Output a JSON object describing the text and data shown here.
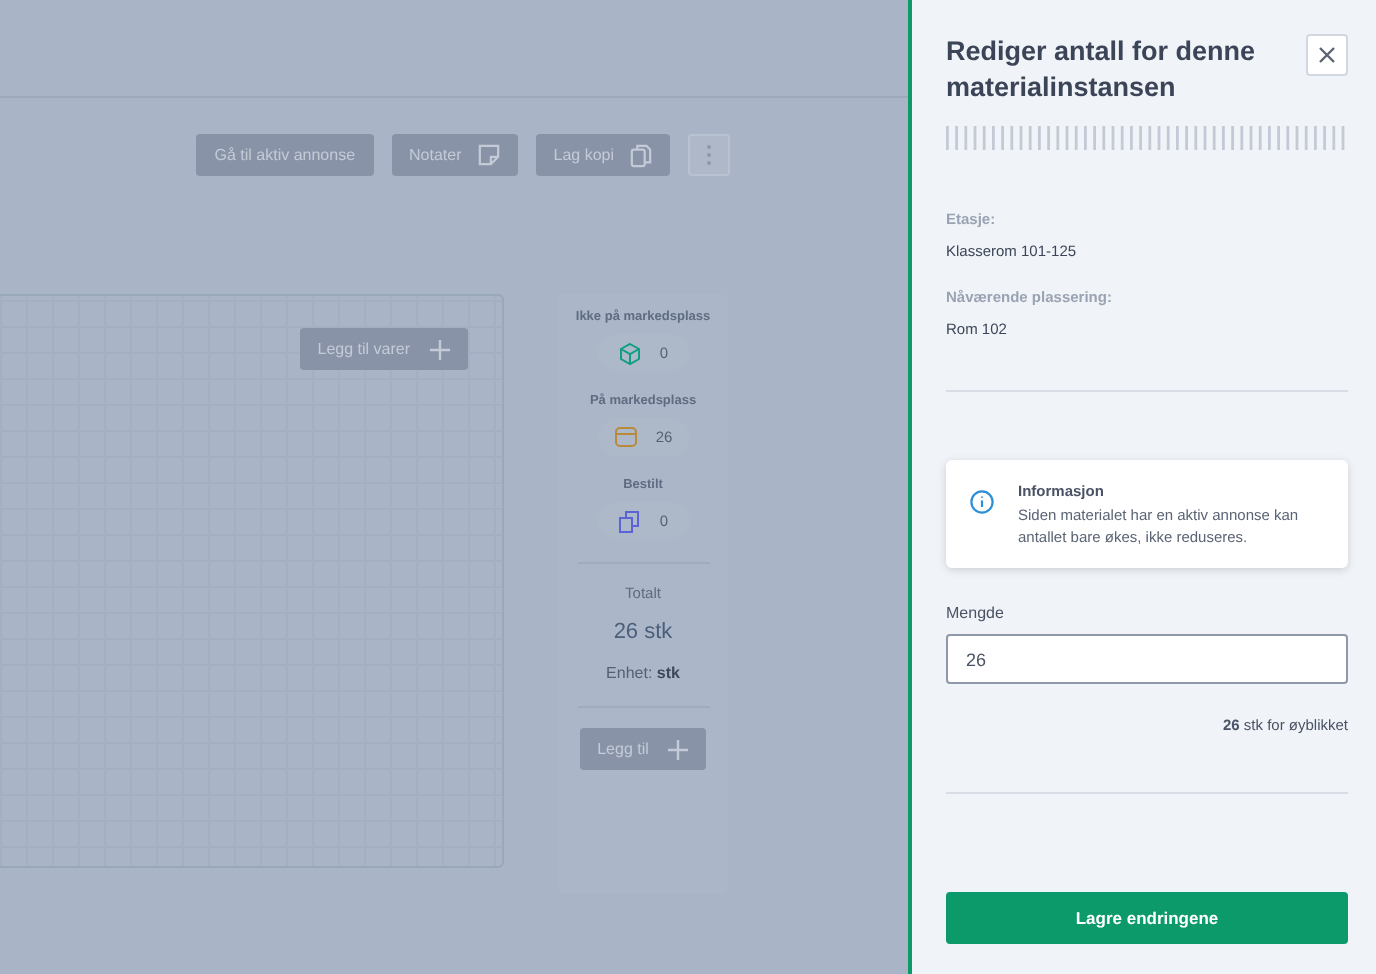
{
  "toolbar": {
    "buttons": [
      {
        "label": "Gå til aktiv annonse"
      },
      {
        "label": "Notater"
      },
      {
        "label": "Lag kopi"
      }
    ]
  },
  "items_panel": {
    "add_button": "Legg til varer"
  },
  "stock": {
    "groups": [
      {
        "label": "Ikke på markedsplass",
        "value": "0",
        "kind": "box",
        "color": "#0f9f80"
      },
      {
        "label": "På markedsplass",
        "value": "26",
        "kind": "store",
        "color": "#b98a3a"
      },
      {
        "label": "Bestilt",
        "value": "0",
        "kind": "order",
        "color": "#5b63d6"
      }
    ],
    "total_label": "Totalt",
    "total": "26 stk",
    "unit": "Enhet: **stk**",
    "add_button": "Legg til"
  },
  "drawer": {
    "title": "Rediger antall for denne materialinstansen",
    "fields": [
      {
        "label": "Etasje:",
        "value": "Klasserom 101-125"
      },
      {
        "label": "Nåværende plassering:",
        "value": "Rom 102"
      }
    ],
    "info": {
      "title": "Informasjon",
      "text": "Siden materialet har en aktiv annonse kan antallet bare økes, ikke reduseres."
    },
    "quantity": {
      "label": "Mengde",
      "value": "26"
    },
    "current": "**26** stk for øyblikket",
    "save_button": "Lagre endringene"
  }
}
